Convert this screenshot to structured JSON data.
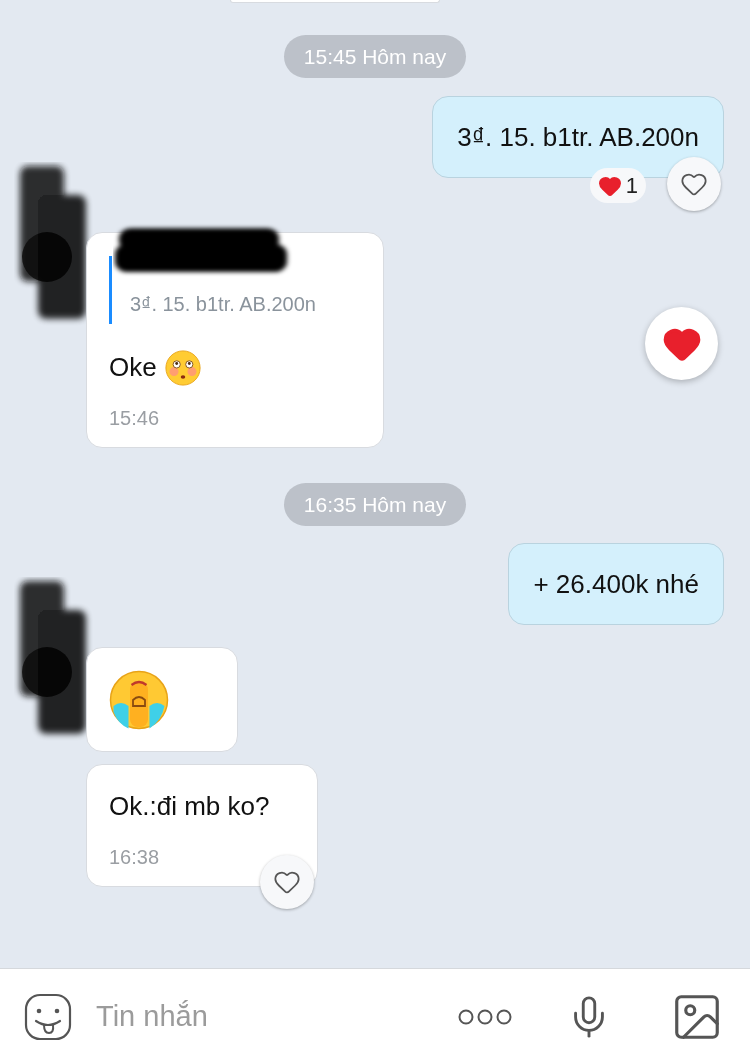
{
  "items": [
    {
      "kind": "time",
      "text": "15:45 Hôm nay"
    },
    {
      "kind": "outgoing",
      "text": "3₫. 15. b1tr. AB.200n",
      "reaction": {
        "count": "1"
      },
      "like": {
        "liked": false
      }
    },
    {
      "kind": "incoming",
      "avatar": true,
      "redacted": true,
      "quote": {
        "text": "3₫. 15. b1tr. AB.200n"
      },
      "text": "Oke",
      "emoji": true,
      "time": "15:46",
      "heart_button": true
    },
    {
      "kind": "time",
      "text": "16:35 Hôm nay"
    },
    {
      "kind": "outgoing",
      "text": "+ 26.400k nhé"
    },
    {
      "kind": "sticker",
      "avatar": true,
      "redacted": true
    },
    {
      "kind": "incoming",
      "avatar": false,
      "text": "Ok.:đi mb ko?",
      "time": "16:38",
      "like": {
        "liked": false
      }
    }
  ],
  "composer": {
    "placeholder": "Tin nhắn"
  }
}
